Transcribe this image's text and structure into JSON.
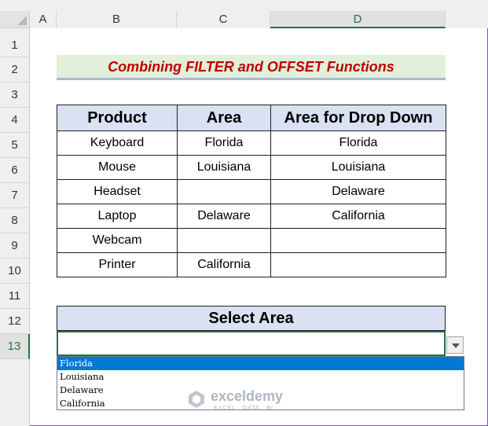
{
  "columns": [
    "A",
    "B",
    "C",
    "D"
  ],
  "rows": [
    "1",
    "2",
    "3",
    "4",
    "5",
    "6",
    "7",
    "8",
    "9",
    "10",
    "11",
    "12",
    "13"
  ],
  "title": "Combining FILTER and OFFSET Functions",
  "table": {
    "headers": [
      "Product",
      "Area",
      "Area for Drop Down"
    ],
    "rows": [
      [
        "Keyboard",
        "Florida",
        "Florida"
      ],
      [
        "Mouse",
        "Louisiana",
        "Louisiana"
      ],
      [
        "Headset",
        "",
        "Delaware"
      ],
      [
        "Laptop",
        "Delaware",
        "California"
      ],
      [
        "Webcam",
        "",
        ""
      ],
      [
        "Printer",
        "California",
        ""
      ]
    ]
  },
  "select": {
    "header": "Select Area",
    "value": "",
    "options": [
      "Florida",
      "Louisiana",
      "Delaware",
      "California"
    ],
    "highlighted": "Florida"
  },
  "watermark": {
    "name": "exceldemy",
    "tagline": "EXCEL · DATA · BI"
  },
  "colors": {
    "title_text": "#c00000",
    "title_fill": "#e2efda",
    "header_fill": "#d9e1f2",
    "selection": "#0078d7",
    "excel_green": "#217346"
  }
}
